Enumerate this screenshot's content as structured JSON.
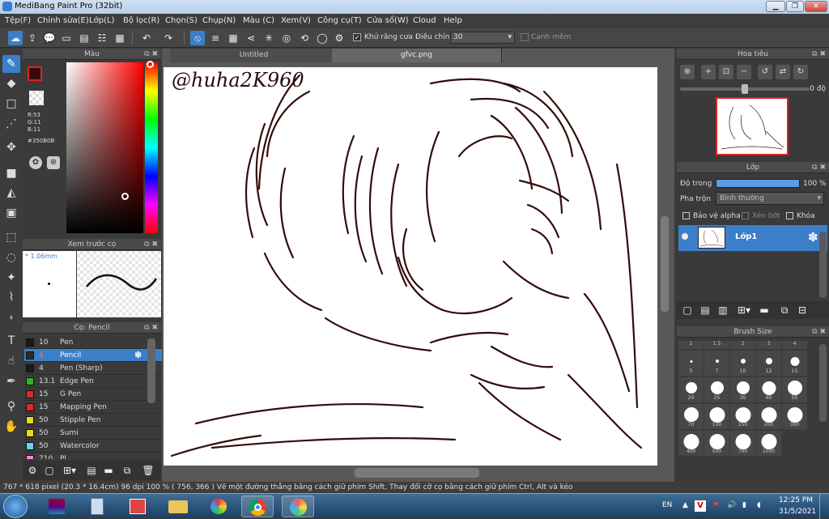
{
  "window": {
    "title": "MediBang Paint Pro (32bit)",
    "minimize": "▁",
    "maximize": "❐",
    "close": "✕"
  },
  "menu": [
    "Tệp(F)",
    "Chỉnh sửa(E)",
    "Lớp(L)",
    "Bộ lọc(R)",
    "Chọn(S)",
    "Chụp(N)",
    "Màu (C)",
    "Xem(V)",
    "Công cụ(T)",
    "Cửa sổ(W)",
    "Cloud",
    "Help"
  ],
  "toolbar": {
    "antialias_label": "Khử răng cưa",
    "adjust_label": "Điều chỉnh",
    "adjust_value": "30",
    "soft_edge_label": "Cạnh mềm"
  },
  "color_panel": {
    "title": "Màu",
    "r": "R:53",
    "g": "G:11",
    "b": "B:11",
    "hex": "#350B0B",
    "current_color": "#350B0B"
  },
  "preview_panel": {
    "title": "Xem trước cọ",
    "size": "* 1.06mm"
  },
  "brush_panel": {
    "title": "Cọ: Pencil",
    "brushes": [
      {
        "size": "10",
        "name": "Pen",
        "color": "#1a1a1a"
      },
      {
        "size": "4",
        "name": "Pencil",
        "color": "#2a2a2a",
        "selected": true
      },
      {
        "size": "4",
        "name": "Pen (Sharp)",
        "color": "#1a1a1a"
      },
      {
        "size": "13.1",
        "name": "Edge Pen",
        "color": "#2db52d"
      },
      {
        "size": "15",
        "name": "G Pen",
        "color": "#e02828"
      },
      {
        "size": "15",
        "name": "Mapping Pen",
        "color": "#e02828"
      },
      {
        "size": "50",
        "name": "Stipple Pen",
        "color": "#e8d820"
      },
      {
        "size": "50",
        "name": "Sumi",
        "color": "#e8d820"
      },
      {
        "size": "50",
        "name": "Watercolor",
        "color": "#6fd0f0"
      },
      {
        "size": "710",
        "name": "Pl",
        "color": "#f08ad0"
      }
    ]
  },
  "tabs": [
    "Untitled",
    "gfvc.png"
  ],
  "canvas": {
    "watermark": "@huha2K960"
  },
  "navigator": {
    "title": "Hoa tiêu",
    "rotation": "0 độ"
  },
  "layer_panel": {
    "title": "Lớp",
    "opacity_label": "Độ trong",
    "opacity_value": "100 %",
    "opacity_fraction": 1.0,
    "blend_label": "Pha trộn",
    "blend_value": "Bình thường",
    "protect_alpha": "Bảo vệ alpha",
    "clipping": "Xén bớt",
    "lock": "Khóa",
    "layer_name": "Lớp1"
  },
  "brush_size_panel": {
    "title": "Brush Size",
    "headers": [
      "1",
      "1.5",
      "2",
      "3",
      "4"
    ],
    "row1": [
      "5",
      "7",
      "10",
      "12",
      "15"
    ],
    "row2": [
      "20",
      "25",
      "30",
      "40",
      "50"
    ],
    "row3": [
      "70",
      "100",
      "150",
      "200",
      "300"
    ],
    "row4": [
      "400",
      "500",
      "700",
      "1000"
    ]
  },
  "statusbar": {
    "text": "767 * 618 pixel   (20.3 * 16.4cm)   96 dpi   100 %   ( 756, 366 )   Vẽ một đường thẳng bằng cách giữ phím Shift, Thay đổi cỡ cọ bằng cách giữ phím Ctrl, Alt và kéo"
  },
  "taskbar": {
    "lang": "EN",
    "time": "12:25 PM",
    "date": "31/5/2021"
  }
}
